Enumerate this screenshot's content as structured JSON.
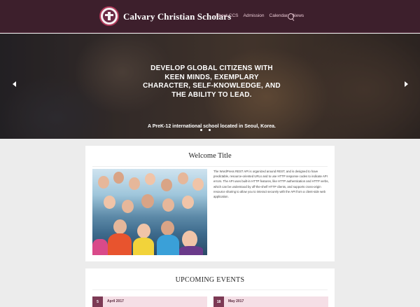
{
  "header": {
    "site_title": "Calvary Christian Scholars",
    "nav": [
      "About CCS",
      "Admission",
      "Calendar",
      "News"
    ]
  },
  "hero": {
    "headline": "DEVELOP GLOBAL CITIZENS WITH KEEN MINDS, EXEMPLARY CHARACTER, SELF-KNOWLEDGE, AND THE ABILITY TO LEAD.",
    "subheadline": "A PreK-12 international school located in Seoul, Korea.",
    "slide_count": 2,
    "active_slide": 1
  },
  "welcome": {
    "title": "Welcome Title",
    "body": "The WordPress REST API is organized around REST, and is designed to have predictable, resource-oriented URLs and to use HTTP response codes to indicate API errors. The API uses built-in HTTP features, like HTTP authentication and HTTP verbs, which can be understood by off-the-shelf HTTP clients, and supports cross-origin resource sharing to allow you to interact securely with the API from a client-side web application."
  },
  "events": {
    "title": "UPCOMING EVENTS",
    "items": [
      {
        "day": "5",
        "month": "April 2017"
      },
      {
        "day": "18",
        "month": "May 2017"
      }
    ]
  },
  "colors": {
    "header_bg": "#3d1f2c",
    "accent": "#7d3a55",
    "event_bg": "#f5dfe6"
  },
  "icons": [
    "logo-seal-icon",
    "search-icon",
    "chevron-left-icon",
    "chevron-right-icon"
  ]
}
